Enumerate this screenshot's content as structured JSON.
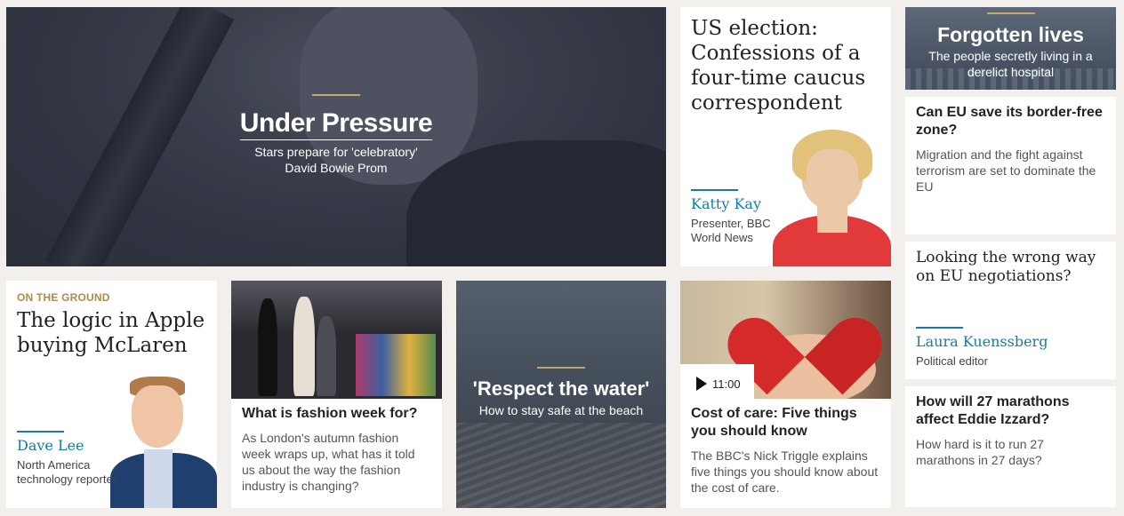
{
  "hero": {
    "title": "Under Pressure",
    "subtitle_line1": "Stars prepare for 'celebratory'",
    "subtitle_line2": "David Bowie Prom"
  },
  "us_election": {
    "title": "US election: Confessions of a four-time caucus correspondent",
    "author": "Katty Kay",
    "role_line1": "Presenter, BBC",
    "role_line2": "World News"
  },
  "forgotten": {
    "title": "Forgotten lives",
    "subtitle_line1": "The people secretly living in a",
    "subtitle_line2": "derelict hospital"
  },
  "eu_border": {
    "title": "Can EU save its border-free zone?",
    "summary": "Migration and the fight against terrorism are set to dominate the EU"
  },
  "eu_negotiations": {
    "title": "Looking the wrong way on EU negotiations?",
    "author": "Laura Kuenssberg",
    "role": "Political editor"
  },
  "apple": {
    "kicker": "ON THE GROUND",
    "title": "The logic in Apple buying McLaren",
    "author": "Dave Lee",
    "role_line1": "North America",
    "role_line2": "technology reporter"
  },
  "fashion": {
    "title": "What is fashion week for?",
    "summary": "As London's autumn fashion week wraps up, what has it told us about the way the fashion industry is changing?"
  },
  "water": {
    "title": "'Respect the water'",
    "subtitle": "How to stay safe at the beach"
  },
  "care": {
    "duration": "11:00",
    "title": "Cost of care: Five things you should know",
    "summary": "The BBC's Nick Triggle explains five things you should know about the cost of care."
  },
  "marathons": {
    "title": "How will 27 marathons affect Eddie Izzard?",
    "summary": "How hard is it to run 27 marathons in 27 days?"
  },
  "colors": {
    "gold_rule": "#c7a56f",
    "author_teal": "#1a7aa0",
    "kicker_gold": "#b08a4a"
  }
}
